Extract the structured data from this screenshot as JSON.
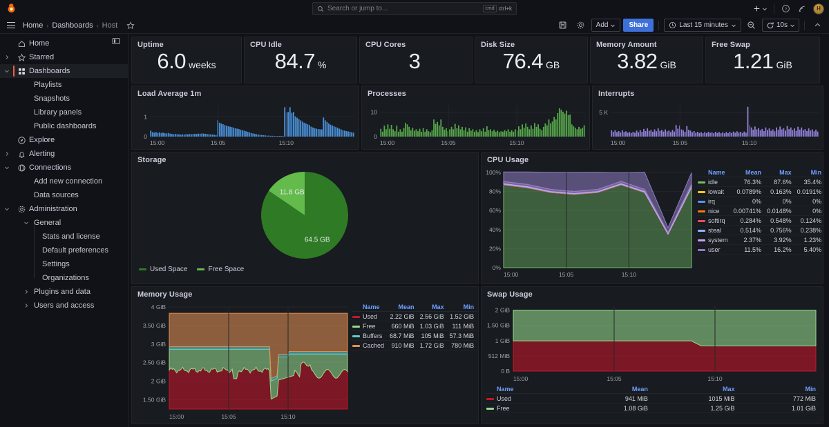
{
  "topbar": {
    "logo_icon": "grafana-logo-icon",
    "search": {
      "placeholder": "Search or jump to...",
      "icon": "search-icon",
      "shortcut_key": "ctrl+k",
      "shortcut_badge": "cmd"
    },
    "add_icon": "plus-icon",
    "chevron_icon": "chevron-down-icon",
    "help_icon": "help-circle-icon",
    "news_icon": "news-rss-icon",
    "avatar_icon": "user-avatar",
    "avatar_initial": "H"
  },
  "breadcrumb": {
    "menu_icon": "hamburger-menu-icon",
    "items": [
      {
        "label": "Home"
      },
      {
        "label": "Dashboards"
      },
      {
        "label": "Host"
      }
    ],
    "separator": "›",
    "star_icon": "star-outline-icon"
  },
  "dashboard_toolbar": {
    "save_icon": "save-disk-icon",
    "settings_icon": "gear-icon",
    "add_label": "Add",
    "add_chevron": "chevron-down-icon",
    "share_label": "Share",
    "time_range": "Last 15 minutes",
    "time_icon": "clock-icon",
    "time_chevron": "chevron-down-icon",
    "zoom_out_icon": "zoom-out-icon",
    "refresh_icon": "refresh-icon",
    "refresh_interval": "10s",
    "refresh_chevron": "chevron-down-icon",
    "collapse_icon": "chevron-up-icon"
  },
  "sidebar": {
    "dock_icon": "dock-menu-icon",
    "items": [
      {
        "label": "Home",
        "icon": "home-icon",
        "level": 0,
        "expandable": false,
        "active": false
      },
      {
        "label": "Starred",
        "icon": "star-icon",
        "level": 0,
        "expandable": true,
        "expanded": false,
        "active": false
      },
      {
        "label": "Dashboards",
        "icon": "dashboards-grid-icon",
        "level": 0,
        "expandable": true,
        "expanded": true,
        "active": true
      },
      {
        "label": "Playlists",
        "icon": "",
        "level": 1,
        "expandable": false,
        "active": false
      },
      {
        "label": "Snapshots",
        "icon": "",
        "level": 1,
        "expandable": false,
        "active": false
      },
      {
        "label": "Library panels",
        "icon": "",
        "level": 1,
        "expandable": false,
        "active": false
      },
      {
        "label": "Public dashboards",
        "icon": "",
        "level": 1,
        "expandable": false,
        "active": false
      },
      {
        "label": "Explore",
        "icon": "compass-icon",
        "level": 0,
        "expandable": false,
        "active": false
      },
      {
        "label": "Alerting",
        "icon": "bell-icon",
        "level": 0,
        "expandable": true,
        "expanded": false,
        "active": false
      },
      {
        "label": "Connections",
        "icon": "connections-icon",
        "level": 0,
        "expandable": true,
        "expanded": true,
        "active": false
      },
      {
        "label": "Add new connection",
        "icon": "",
        "level": 1,
        "expandable": false,
        "active": false
      },
      {
        "label": "Data sources",
        "icon": "",
        "level": 1,
        "expandable": false,
        "active": false
      },
      {
        "label": "Administration",
        "icon": "gear-icon",
        "level": 0,
        "expandable": true,
        "expanded": true,
        "active": false
      },
      {
        "label": "General",
        "icon": "",
        "level": 1,
        "expandable": true,
        "expanded": true,
        "active": false
      },
      {
        "label": "Stats and license",
        "icon": "",
        "level": 2,
        "expandable": false,
        "active": false
      },
      {
        "label": "Default preferences",
        "icon": "",
        "level": 2,
        "expandable": false,
        "active": false
      },
      {
        "label": "Settings",
        "icon": "",
        "level": 2,
        "expandable": false,
        "active": false
      },
      {
        "label": "Organizations",
        "icon": "",
        "level": 2,
        "expandable": false,
        "active": false
      },
      {
        "label": "Plugins and data",
        "icon": "",
        "level": 1,
        "expandable": true,
        "expanded": false,
        "active": false
      },
      {
        "label": "Users and access",
        "icon": "",
        "level": 1,
        "expandable": true,
        "expanded": false,
        "active": false
      }
    ]
  },
  "stats": [
    {
      "title": "Uptime",
      "value": "6.0",
      "unit": "weeks"
    },
    {
      "title": "CPU Idle",
      "value": "84.7",
      "unit": "%"
    },
    {
      "title": "CPU Cores",
      "value": "3",
      "unit": ""
    },
    {
      "title": "Disk Size",
      "value": "76.4",
      "unit": "GB"
    },
    {
      "title": "Memory Amount",
      "value": "3.82",
      "unit": "GiB"
    },
    {
      "title": "Free Swap",
      "value": "1.21",
      "unit": "GiB"
    }
  ],
  "chart_data": [
    {
      "type": "bar",
      "panel": "load-average-1m",
      "title": "Load Average 1m",
      "color": "#4a90d9",
      "xlabel": "",
      "ylabel": "",
      "ylim": [
        0,
        1.6
      ],
      "yticks": [
        "0",
        "1"
      ],
      "ytick_values": [
        0,
        1
      ],
      "xticks": [
        "15:00",
        "15:05",
        "15:10"
      ],
      "values": [
        0.3,
        0.22,
        0.2,
        0.22,
        0.19,
        0.21,
        0.18,
        0.2,
        0.17,
        0.16,
        0.18,
        0.15,
        0.13,
        0.12,
        0.13,
        0.12,
        0.11,
        0.1,
        0.11,
        0.1,
        0.12,
        0.11,
        0.13,
        0.12,
        0.13,
        0.14,
        0.13,
        0.15,
        0.14,
        0.16,
        0.15,
        0.14,
        0.13,
        0.12,
        0.11,
        0.1,
        0.09,
        0.08,
        0.82,
        0.7,
        0.66,
        0.62,
        0.58,
        0.55,
        0.52,
        0.5,
        0.48,
        0.45,
        0.42,
        0.4,
        0.38,
        0.35,
        0.32,
        0.3,
        0.27,
        0.24,
        0.21,
        0.18,
        0.16,
        0.14,
        0.12,
        0.1,
        0.09,
        0.08,
        0.07,
        0.06,
        0.05,
        0.05,
        0.04,
        0.04,
        0.03,
        0.03,
        0.03,
        0.02,
        0.02,
        0.02,
        1.48,
        1.22,
        1.24,
        1.48,
        1.2,
        1.24,
        1.02,
        0.95,
        0.88,
        0.82,
        0.76,
        0.7,
        0.66,
        0.62,
        0.58,
        0.5,
        0.46,
        0.42,
        0.4,
        0.38,
        0.37,
        0.36,
        0.96,
        0.82,
        0.74,
        0.66,
        0.6,
        0.56,
        0.52,
        0.48,
        0.44,
        0.4,
        0.36,
        0.32,
        0.3,
        0.28,
        0.26,
        0.24,
        0.22,
        0.2
      ]
    },
    {
      "type": "bar",
      "panel": "processes",
      "title": "Processes",
      "color": "#56a64b",
      "xlabel": "",
      "ylabel": "",
      "ylim": [
        0,
        13
      ],
      "yticks": [
        "0",
        "10"
      ],
      "ytick_values": [
        0,
        10
      ],
      "xticks": [
        "15:00",
        "15:05",
        "15:10"
      ],
      "values": [
        3.2,
        2.0,
        4.5,
        3.0,
        5.0,
        3.2,
        4.8,
        3.0,
        2.2,
        4.5,
        2.0,
        3.0,
        2.0,
        3.5,
        5.6,
        5.0,
        4.0,
        2.6,
        3.6,
        2.4,
        3.0,
        2.2,
        3.2,
        2.0,
        3.4,
        2.0,
        3.0,
        2.2,
        1.8,
        2.6,
        7.0,
        5.2,
        6.0,
        4.6,
        7.0,
        4.0,
        2.8,
        3.4,
        2.2,
        3.0,
        4.0,
        3.0,
        5.2,
        3.4,
        4.6,
        3.0,
        4.0,
        2.6,
        3.8,
        2.0,
        3.4,
        2.4,
        3.0,
        2.0,
        2.6,
        1.8,
        3.0,
        2.2,
        3.4,
        2.0,
        4.2,
        2.6,
        3.0,
        2.2,
        2.8,
        2.0,
        2.4,
        1.8,
        2.2,
        2.0,
        2.6,
        2.2,
        3.0,
        2.0,
        2.6,
        2.0,
        3.0,
        2.4,
        4.2,
        3.0,
        5.0,
        3.6,
        5.4,
        4.0,
        3.0,
        4.6,
        3.2,
        5.6,
        4.0,
        5.0,
        3.2,
        2.6,
        4.0,
        5.4,
        4.6,
        7.0,
        5.4,
        6.2,
        8.0,
        7.0,
        9.6,
        11.6,
        11.0,
        10.2,
        9.4,
        10.6,
        8.8,
        9.0,
        5.0,
        4.2,
        3.6,
        3.0,
        4.0,
        3.2,
        3.6,
        4.6
      ]
    },
    {
      "type": "bar",
      "panel": "interrupts",
      "title": "Interrupts",
      "color": "#8f7fd6",
      "xlabel": "",
      "ylabel": "",
      "ylim": [
        0,
        6600
      ],
      "yticks": [
        "5 K"
      ],
      "ytick_values": [
        5000
      ],
      "xticks": [
        "15:00",
        "15:05",
        "15:10"
      ],
      "values": [
        1300,
        1000,
        1300,
        900,
        1150,
        850,
        1300,
        950,
        1100,
        800,
        950,
        750,
        1000,
        800,
        1250,
        900,
        1350,
        1000,
        1600,
        1150,
        1700,
        1200,
        1350,
        1000,
        1500,
        1100,
        1700,
        1200,
        1400,
        1050,
        1500,
        1100,
        1250,
        950,
        1400,
        1050,
        2400,
        1650,
        2300,
        1500,
        1300,
        1000,
        2200,
        1400,
        1250,
        900,
        1150,
        800,
        1000,
        750,
        900,
        700,
        950,
        720,
        1000,
        780,
        900,
        700,
        1000,
        760,
        950,
        700,
        880,
        680,
        950,
        720,
        1000,
        760,
        1050,
        800,
        1100,
        820,
        1000,
        760,
        1050,
        800,
        6200,
        2350,
        1900,
        1450,
        2100,
        1500,
        1750,
        1300,
        1600,
        1150,
        1900,
        1350,
        1700,
        1200,
        1500,
        1100,
        1900,
        1400,
        2100,
        1500,
        1750,
        1250,
        2200,
        1550,
        1900,
        1350,
        1700,
        1200,
        2050,
        1450,
        1900,
        1350,
        1550,
        1150,
        1700,
        1250,
        1500,
        1100,
        1450,
        1050
      ]
    },
    {
      "type": "pie",
      "panel": "storage",
      "title": "Storage",
      "labels": [
        "Used Space",
        "Free Space"
      ],
      "values": [
        64.5,
        11.8
      ],
      "value_labels": [
        "64.5 GB",
        "11.8 GB"
      ],
      "unit": "GB",
      "colors": [
        "#2f7a24",
        "#63bb4b"
      ],
      "legend_position": "bottom"
    },
    {
      "type": "area",
      "panel": "cpu-usage",
      "title": "CPU Usage",
      "stacked": true,
      "xlabel": "",
      "ylabel": "",
      "ylim": [
        0,
        100
      ],
      "yticks": [
        "0%",
        "20%",
        "40%",
        "60%",
        "80%",
        "100%"
      ],
      "ytick_values": [
        0,
        20,
        40,
        60,
        80,
        100
      ],
      "xticks": [
        "15:00",
        "15:05",
        "15:10"
      ],
      "legend_headers": [
        "Name",
        "Mean",
        "Max",
        "Min"
      ],
      "series": [
        {
          "name": "idle",
          "color": "#73bf69",
          "mean": "76.3%",
          "max": "87.6%",
          "min": "35.4%",
          "values": [
            87,
            84,
            79,
            77,
            79,
            87,
            79,
            35,
            84
          ]
        },
        {
          "name": "iowait",
          "color": "#f2cc0c",
          "mean": "0.0789%",
          "max": "0.163%",
          "min": "0.0191%",
          "values": [
            0.1,
            0.1,
            0.1,
            0.1,
            0.1,
            0.1,
            0.1,
            0.05,
            0.1
          ]
        },
        {
          "name": "irq",
          "color": "#5794f2",
          "mean": "0%",
          "max": "0%",
          "min": "0%",
          "values": [
            0,
            0,
            0,
            0,
            0,
            0,
            0,
            0,
            0
          ]
        },
        {
          "name": "nice",
          "color": "#ff780a",
          "mean": "0.00741%",
          "max": "0.0148%",
          "min": "0%",
          "values": [
            0.01,
            0.01,
            0.01,
            0.01,
            0.01,
            0.01,
            0.01,
            0,
            0.01
          ]
        },
        {
          "name": "softirq",
          "color": "#f2495c",
          "mean": "0.284%",
          "max": "0.548%",
          "min": "0.124%",
          "values": [
            0.4,
            0.4,
            0.3,
            0.3,
            0.3,
            0.4,
            0.3,
            0.2,
            0.4
          ]
        },
        {
          "name": "steal",
          "color": "#8ab8ff",
          "mean": "0.514%",
          "max": "0.756%",
          "min": "0.238%",
          "values": [
            0.6,
            0.6,
            0.5,
            0.5,
            0.5,
            0.6,
            0.5,
            0.3,
            0.6
          ]
        },
        {
          "name": "system",
          "color": "#c8a2f5",
          "mean": "2.37%",
          "max": "3.92%",
          "min": "1.23%",
          "values": [
            2.4,
            2.4,
            2.3,
            2.2,
            2.3,
            2.5,
            2.4,
            1.4,
            2.6
          ]
        },
        {
          "name": "user",
          "color": "#8e7cc3",
          "mean": "11.5%",
          "max": "16.2%",
          "min": "5.40%",
          "values": [
            10,
            13,
            18,
            20,
            18,
            9,
            18,
            5,
            12
          ]
        }
      ]
    },
    {
      "type": "area",
      "panel": "memory-usage",
      "title": "Memory Usage",
      "stacked": true,
      "xlabel": "",
      "ylabel": "",
      "ylim": [
        1.25,
        4.0
      ],
      "yticks": [
        "1.50 GiB",
        "2 GiB",
        "2.50 GiB",
        "3 GiB",
        "3.50 GiB",
        "4 GiB"
      ],
      "ytick_values": [
        1.5,
        2,
        2.5,
        3,
        3.5,
        4
      ],
      "xticks": [
        "15:00",
        "15:05",
        "15:10"
      ],
      "legend_headers": [
        "Name",
        "Mean",
        "Max",
        "Min"
      ],
      "series": [
        {
          "name": "Used",
          "color": "#c4162a",
          "mean": "2.22 GiB",
          "max": "2.56 GiB",
          "min": "1.52 GiB"
        },
        {
          "name": "Free",
          "color": "#96d98d",
          "mean": "660 MiB",
          "max": "1.03 GiB",
          "min": "111 MiB"
        },
        {
          "name": "Buffers",
          "color": "#5ecdcd",
          "mean": "68.7 MiB",
          "max": "105 MiB",
          "min": "57.3 MiB"
        },
        {
          "name": "Cached",
          "color": "#e08f52",
          "mean": "910 MiB",
          "max": "1.72 GiB",
          "min": "780 MiB"
        }
      ]
    },
    {
      "type": "area",
      "panel": "swap-usage",
      "title": "Swap Usage",
      "stacked": true,
      "xlabel": "",
      "ylabel": "",
      "ylim": [
        0,
        2.15
      ],
      "yticks": [
        "0 B",
        "512 MiB",
        "1 GiB",
        "1.50 GiB",
        "2 GiB"
      ],
      "ytick_values": [
        0,
        0.5,
        1,
        1.5,
        2
      ],
      "xticks": [
        "15:00",
        "15:05",
        "15:10"
      ],
      "legend_headers": [
        "Name",
        "Mean",
        "Max",
        "Min"
      ],
      "series": [
        {
          "name": "Used",
          "color": "#c4162a",
          "mean": "941 MiB",
          "max": "1015 MiB",
          "min": "772 MiB"
        },
        {
          "name": "Free",
          "color": "#96d98d",
          "mean": "1.08 GiB",
          "max": "1.25 GiB",
          "min": "1.01 GiB"
        }
      ]
    }
  ]
}
